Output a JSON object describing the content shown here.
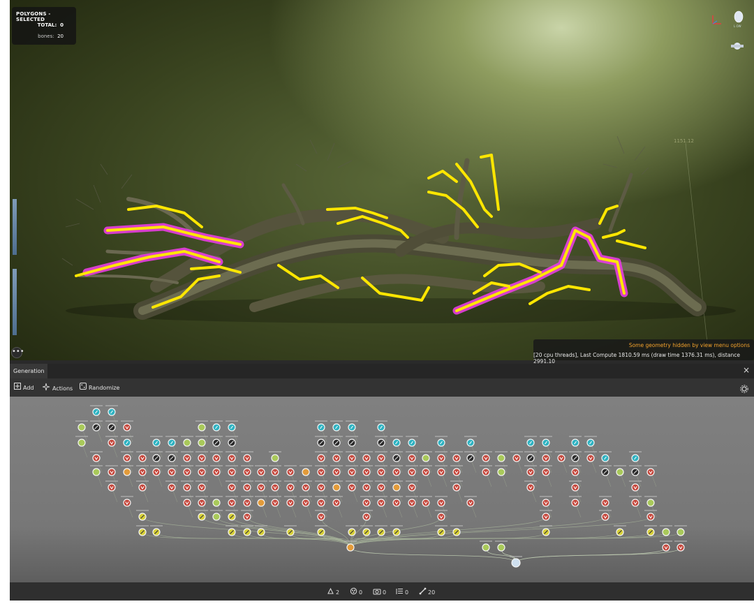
{
  "viewport": {
    "stats": {
      "title": "POLYGONS - SELECTED",
      "total_label": "TOTAL:",
      "total_value": "0",
      "bones_label": "bones:",
      "bones_value": "20"
    },
    "distance_label": "1151.12",
    "notice_warning": "Some geometry hidden by view menu options",
    "notice_info": "[20 cpu threads], Last Compute 1810.59 ms (draw time 1376.31 ms), distance 2991.10",
    "more_button": "•••",
    "light_label": "L OW"
  },
  "panel": {
    "tab_label": "Generation",
    "close_glyph": "×"
  },
  "toolbar": {
    "add_label": "Add",
    "actions_label": "Actions",
    "randomize_label": "Randomize"
  },
  "statusbar": {
    "meshes": "2",
    "materials": "0",
    "cameras": "0",
    "layers": "0",
    "bones": "20"
  },
  "colors": {
    "selection_yellow": "#ffe600",
    "selection_magenta": "#e83ee0",
    "warning_orange": "#f3a22c",
    "node_red": "#c5463b",
    "node_teal": "#2fb3c2",
    "node_yellow": "#d8d13a",
    "node_green": "#a9c95a",
    "node_orange": "#e39b3a"
  }
}
